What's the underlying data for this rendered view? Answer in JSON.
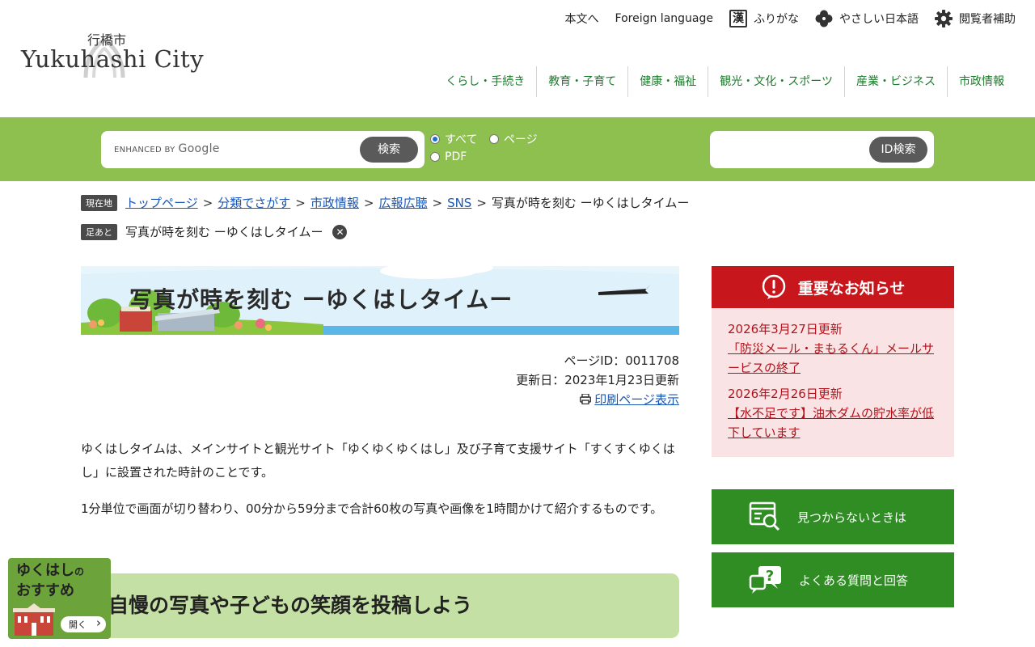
{
  "header": {
    "logo_jp": "行橋市",
    "logo_en": "Yukuhashi City",
    "util_links": {
      "main_content": "本文へ",
      "foreign": "Foreign language",
      "furigana_icon": "漢",
      "furigana": "ふりがな",
      "easy_japanese": "やさしい日本語",
      "accessibility": "閲覧者補助"
    },
    "gnav": [
      "くらし・手続き",
      "教育・子育て",
      "健康・福祉",
      "観光・文化・スポーツ",
      "産業・ビジネス",
      "市政情報"
    ]
  },
  "search": {
    "placeholder_prefix": "ENHANCED BY",
    "placeholder_brand": "Google",
    "button": "検索",
    "options": [
      "すべて",
      "ページ",
      "PDF"
    ],
    "selected": "すべて",
    "id_button": "ID検索"
  },
  "breadcrumb": {
    "tag": "現在地",
    "links": [
      "トップページ",
      "分類でさがす",
      "市政情報",
      "広報広聴",
      "SNS"
    ],
    "current": "写真が時を刻む ーゆくはしタイムー"
  },
  "history": {
    "tag": "足あと",
    "item": "写真が時を刻む ーゆくはしタイムー"
  },
  "banner": {
    "title": "写真が時を刻む ーゆくはしタイムー"
  },
  "meta": {
    "page_id": "ページID：0011708",
    "updated": "更新日：2023年1月23日更新",
    "print": "印刷ページ表示"
  },
  "content": {
    "p1": "ゆくはしタイムは、メインサイトと観光サイト「ゆくゆくゆくはし」及び子育て支援サイト「すくすくゆくはし」に設置された時計のことです。",
    "p2": "1分単位で画面が切り替わり、00分から59分まで合計60枚の写真や画像を1時間かけて紹介するものです。",
    "h2": "自慢の写真や子どもの笑顔を投稿しよう"
  },
  "recommend": {
    "line1": "ゆくはし",
    "line1_small": "の",
    "line2": "おすすめ",
    "open": "開く"
  },
  "notice": {
    "title": "重要なお知らせ",
    "items": [
      {
        "date": "2026年3月27日更新",
        "text": "「防災メール・まもるくん」メールサービスの終了"
      },
      {
        "date": "2026年2月26日更新",
        "text": "【水不足です】油木ダムの貯水率が低下しています"
      }
    ]
  },
  "side_buttons": {
    "not_found": "見つからないときは",
    "faq": "よくある質問と回答"
  },
  "colors": {
    "brand_green": "#8dc04e",
    "nav_green": "#1d7a2c",
    "button_green": "#2f8d24",
    "notice_red": "#c8161d",
    "notice_bg": "#fae3e4",
    "link_blue": "#1a56b4"
  }
}
